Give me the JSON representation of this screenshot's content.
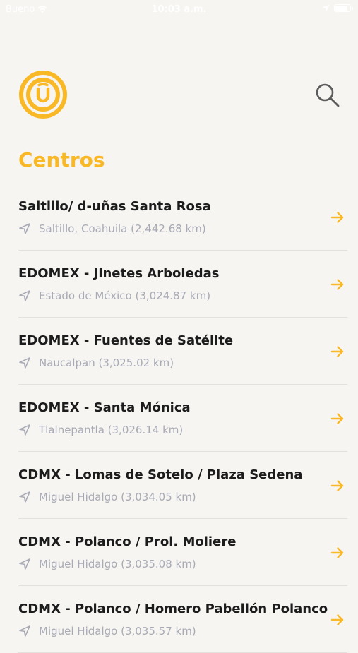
{
  "status_bar": {
    "carrier": "Bueno",
    "time": "10:03 a.m.",
    "battery_level": 0.85
  },
  "header": {
    "logo_icon": "u-circle-logo-icon",
    "search_icon": "search-icon"
  },
  "page": {
    "title": "Centros"
  },
  "accent_color": "#f9b926",
  "centros": [
    {
      "name": "Saltillo/ d-uñas Santa Rosa",
      "location": "Saltillo, Coahuila (2,442.68 km)"
    },
    {
      "name": "EDOMEX - Jinetes Arboledas",
      "location": "Estado de México (3,024.87 km)"
    },
    {
      "name": "EDOMEX - Fuentes de Satélite",
      "location": "Naucalpan (3,025.02 km)"
    },
    {
      "name": "EDOMEX - Santa Mónica",
      "location": "Tlalnepantla (3,026.14 km)"
    },
    {
      "name": "CDMX - Lomas de Sotelo / Plaza Sedena",
      "location": "Miguel Hidalgo (3,034.05 km)"
    },
    {
      "name": "CDMX - Polanco / Prol. Moliere",
      "location": "Miguel Hidalgo (3,035.08 km)"
    },
    {
      "name": "CDMX - Polanco / Homero Pabellón Polanco",
      "location": "Miguel Hidalgo (3,035.57 km)"
    }
  ]
}
